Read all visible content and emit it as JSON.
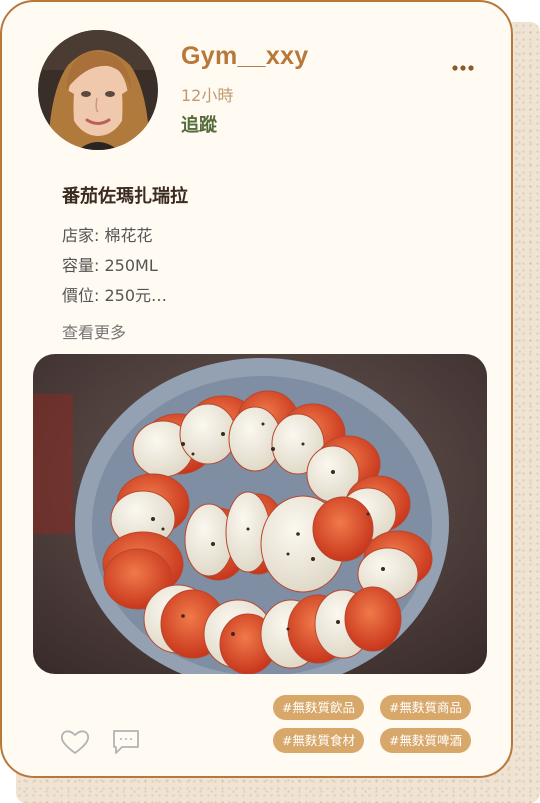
{
  "post": {
    "username": "Gym__xxy",
    "time": "12小時",
    "follow_label": "追蹤",
    "title": "番茄佐瑪扎瑞拉",
    "details": [
      "店家: 棉花花",
      "容量: 250ML",
      "價位: 250元…"
    ],
    "see_more_label": "查看更多"
  },
  "icons": {
    "more": "more-dots-icon",
    "like": "heart-icon",
    "comment": "comment-bubble-icon"
  },
  "tags": [
    "#無麩質飲品",
    "#無麩質商品",
    "#無麩質食材",
    "#無麩質啤酒"
  ],
  "colors": {
    "accent": "#b8783a",
    "follow": "#556b3a",
    "tag_bg": "#d8a76a",
    "card_bg": "#fffaf2"
  }
}
